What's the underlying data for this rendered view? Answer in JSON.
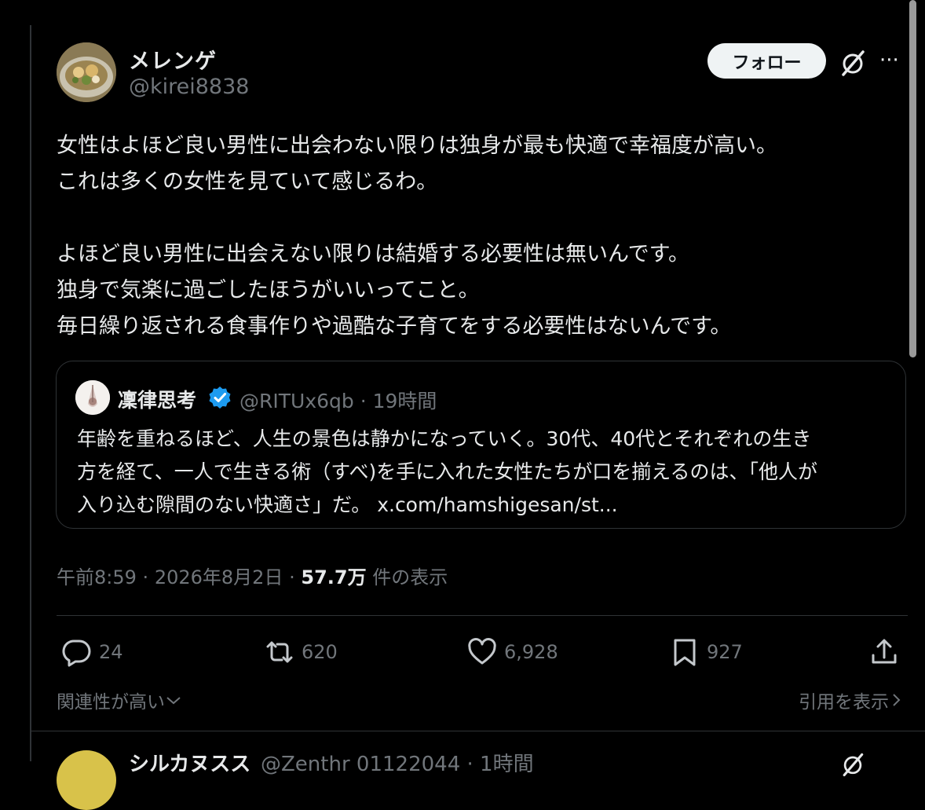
{
  "tweet": {
    "author": {
      "display_name": "メレンゲ",
      "handle": "@kirei8838",
      "avatar_icon": "food-bowl-avatar"
    },
    "follow_label": "フォロー",
    "grok_icon": "grok-slash-icon",
    "more_icon": "more-dots-icon",
    "more_label": "···",
    "text_lines": [
      "女性はよほど良い男性に出会わない限りは独身が最も快適で幸福度が高い。",
      "これは多くの女性を見ていて感じるわ。",
      "",
      "よほど良い男性に出会えない限りは結婚する必要性は無いんです。",
      "独身で気楽に過ごしたほうがいいってこと。",
      "毎日繰り返される食事作りや過酷な子育てをする必要性はないんです。"
    ],
    "quoted": {
      "name": "凜律思考",
      "verified": true,
      "handle": "@RITUx6qb",
      "separator": "·",
      "time": "19時間",
      "text_lines": [
        "年齢を重ねるほど、人生の景色は静かになっていく。30代、40代とそれぞれの生き",
        "方を経て、一人で生きる術（すべ)を手に入れた女性たちが口を揃えるのは、「他人が",
        "入り込む隙間のない快適さ」だ。 x.com/hamshigesan/st..."
      ]
    },
    "meta": {
      "time": "午前8:59",
      "dot1": "·",
      "date": "2026年8月2日",
      "dot2": "·",
      "views": "57.7万",
      "views_label": "件の表示"
    },
    "actions": {
      "reply": "24",
      "retweet": "620",
      "like": "6,928",
      "bookmark": "927"
    },
    "sort_label": "関連性が高い",
    "quotes_label": "引用を表示"
  },
  "next_tweet": {
    "display_name": "シルカヌスス",
    "handle": "@Zenthr 01122044 · 1時間"
  },
  "colors": {
    "background": "#000000",
    "text": "#e7e9ea",
    "muted": "#71767b",
    "border": "#2f3336",
    "verified": "#1d9bf0"
  }
}
